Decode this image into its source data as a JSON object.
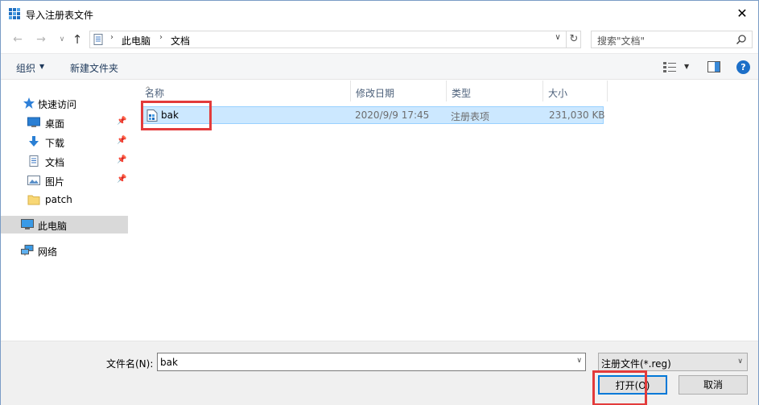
{
  "window": {
    "title": "导入注册表文件",
    "close_glyph": "✕"
  },
  "nav": {
    "back_glyph": "←",
    "forward_glyph": "→",
    "recent_glyph": "∨",
    "up_glyph": "↑"
  },
  "address": {
    "sep_glyph": "›",
    "crumbs": [
      "此电脑",
      "文档"
    ],
    "dropdown_glyph": "∨",
    "refresh_glyph": "↻"
  },
  "search": {
    "placeholder": "搜索\"文档\""
  },
  "toolbar": {
    "organize": "组织",
    "organize_caret": "▼",
    "new_folder": "新建文件夹",
    "view_caret": "▼",
    "help_glyph": "?"
  },
  "sidebar": {
    "pin_glyph": "📌",
    "items": [
      {
        "label": "快速访问",
        "icon": "star-icon"
      },
      {
        "label": "桌面",
        "icon": "desktop-icon"
      },
      {
        "label": "下载",
        "icon": "download-icon"
      },
      {
        "label": "文档",
        "icon": "document-icon"
      },
      {
        "label": "图片",
        "icon": "picture-icon"
      },
      {
        "label": "patch",
        "icon": "folder-icon"
      },
      {
        "label": "此电脑",
        "icon": "computer-icon"
      },
      {
        "label": "网络",
        "icon": "network-icon"
      }
    ]
  },
  "columns": {
    "name": "名称",
    "date": "修改日期",
    "type": "类型",
    "size": "大小",
    "sort_glyph": "^"
  },
  "files": [
    {
      "name": "bak",
      "date": "2020/9/9 17:45",
      "type": "注册表项",
      "size": "231,030 KB",
      "icon": "registry-file-icon"
    }
  ],
  "footer": {
    "filename_label": "文件名(N):",
    "filename_value": "bak",
    "filetype": "注册文件(*.reg)",
    "open_button": "打开(O)",
    "cancel_button": "取消",
    "caret": "∨"
  },
  "colors": {
    "selection": "#cce8ff",
    "highlight": "#e33b3b",
    "accent": "#0078d7"
  }
}
